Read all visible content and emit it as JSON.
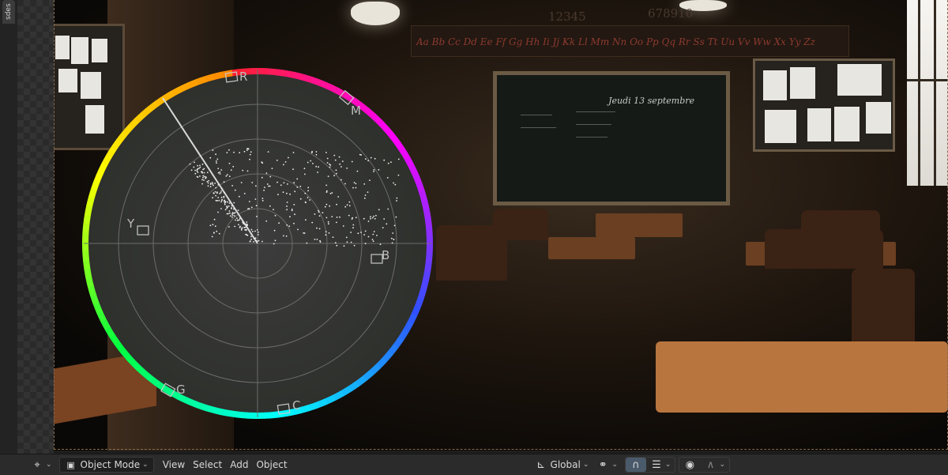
{
  "side_panel": {
    "tab_label": "sdes"
  },
  "viewport": {
    "banner_text": "Aa Bb Cc Dd Ee Ff Gg Hh Ii Jj Kk Ll Mm Nn Oo Pp Qq Rr Ss Tt Uu Vv Ww Xx Yy Zz",
    "numbers_left": "12345",
    "numbers_right": "678910",
    "chalkboard_date": "Jeudi 13 septembre"
  },
  "vectorscope": {
    "ring_colors": [
      "#ff2030",
      "#ff00ff",
      "#3050ff",
      "#00ffff",
      "#00ff40",
      "#ffff00",
      "#ff8000"
    ],
    "labels": {
      "r": "R",
      "m": "M",
      "b": "B",
      "c": "C",
      "g": "G",
      "y": "Y"
    }
  },
  "toolbar": {
    "transform_icon": "transform-pivot-icon",
    "mode_label": "Object Mode",
    "menu_view": "View",
    "menu_select": "Select",
    "menu_add": "Add",
    "menu_object": "Object",
    "orientation_label": "Global",
    "snap_icon": "magnet-icon",
    "proportional_icon": "proportional-edit-icon",
    "link_icon": "link-icon"
  }
}
